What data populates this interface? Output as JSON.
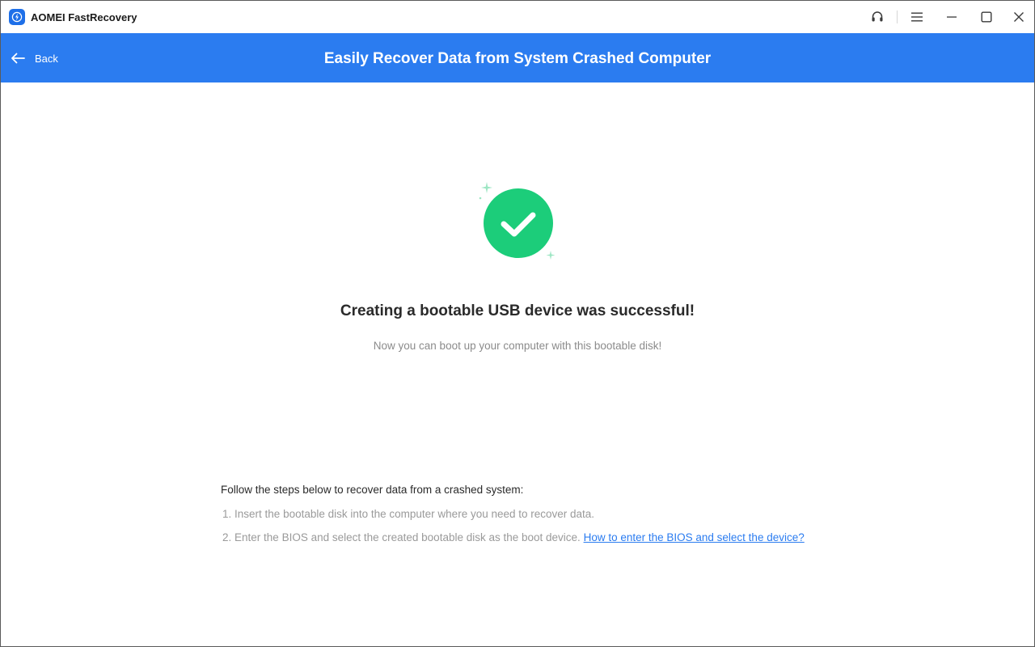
{
  "window": {
    "app_title": "AOMEI FastRecovery",
    "controls": [
      "headset-icon",
      "menu-icon",
      "minimize-icon",
      "maximize-icon",
      "close-icon"
    ]
  },
  "header": {
    "back_label": "Back",
    "title": "Easily Recover Data from System Crashed Computer",
    "background": "#2b7cf0"
  },
  "result": {
    "icon": "check-circle-icon",
    "icon_color": "#1ccd7a",
    "headline": "Creating a bootable USB device was successful!",
    "subline": "Now you can boot up your computer with this bootable disk!"
  },
  "steps": {
    "intro": "Follow the steps below to recover data from a crashed system:",
    "items": [
      {
        "number": "1.",
        "text": "Insert the bootable disk into the computer where you need to recover data.",
        "link": ""
      },
      {
        "number": "2.",
        "text": "Enter the BIOS and select the created bootable disk as the boot device.",
        "link": "How to enter the BIOS and select the device?"
      }
    ]
  }
}
